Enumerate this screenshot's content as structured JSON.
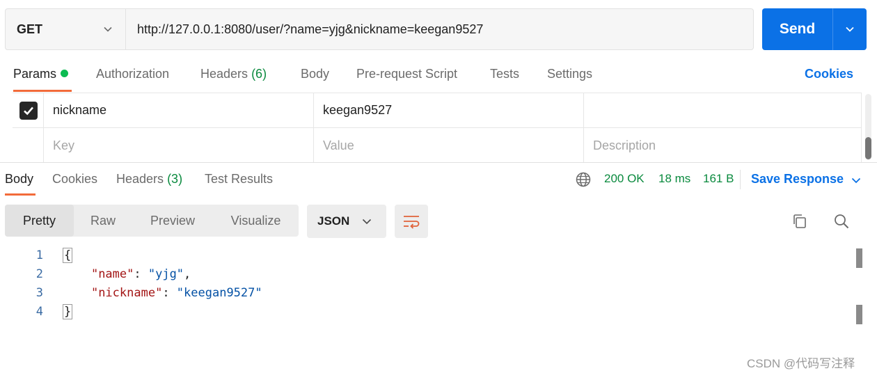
{
  "request": {
    "method": "GET",
    "url": "http://127.0.0.1:8080/user/?name=yjg&nickname=keegan9527",
    "send_label": "Send"
  },
  "request_tabs": [
    {
      "label": "Params",
      "active": true,
      "has_dot": true
    },
    {
      "label": "Authorization"
    },
    {
      "label": "Headers",
      "count": "(6)"
    },
    {
      "label": "Body"
    },
    {
      "label": "Pre-request Script"
    },
    {
      "label": "Tests"
    },
    {
      "label": "Settings"
    }
  ],
  "cookies_label": "Cookies",
  "params": {
    "rows": [
      {
        "checked": true,
        "key": "nickname",
        "value": "keegan9527",
        "description": ""
      }
    ],
    "placeholders": {
      "key": "Key",
      "value": "Value",
      "description": "Description"
    }
  },
  "response_tabs": [
    {
      "label": "Body",
      "active": true
    },
    {
      "label": "Cookies"
    },
    {
      "label": "Headers",
      "count": "(3)"
    },
    {
      "label": "Test Results"
    }
  ],
  "response_status": {
    "status": "200 OK",
    "time": "18 ms",
    "size": "161 B"
  },
  "save_response_label": "Save Response",
  "view_modes": [
    {
      "label": "Pretty",
      "active": true
    },
    {
      "label": "Raw"
    },
    {
      "label": "Preview"
    },
    {
      "label": "Visualize"
    }
  ],
  "format": "JSON",
  "code_lines": [
    "1",
    "2",
    "3",
    "4"
  ],
  "response_body": {
    "open": "{",
    "name_key": "\"name\"",
    "name_value": "\"yjg\"",
    "nickname_key": "\"nickname\"",
    "nickname_value": "\"keegan9527\"",
    "close": "}"
  },
  "watermark": "CSDN @代码写注释",
  "colors": {
    "accent_blue": "#0b71e6",
    "tab_orange": "#f26b3a",
    "status_green": "#0a8a3e"
  }
}
